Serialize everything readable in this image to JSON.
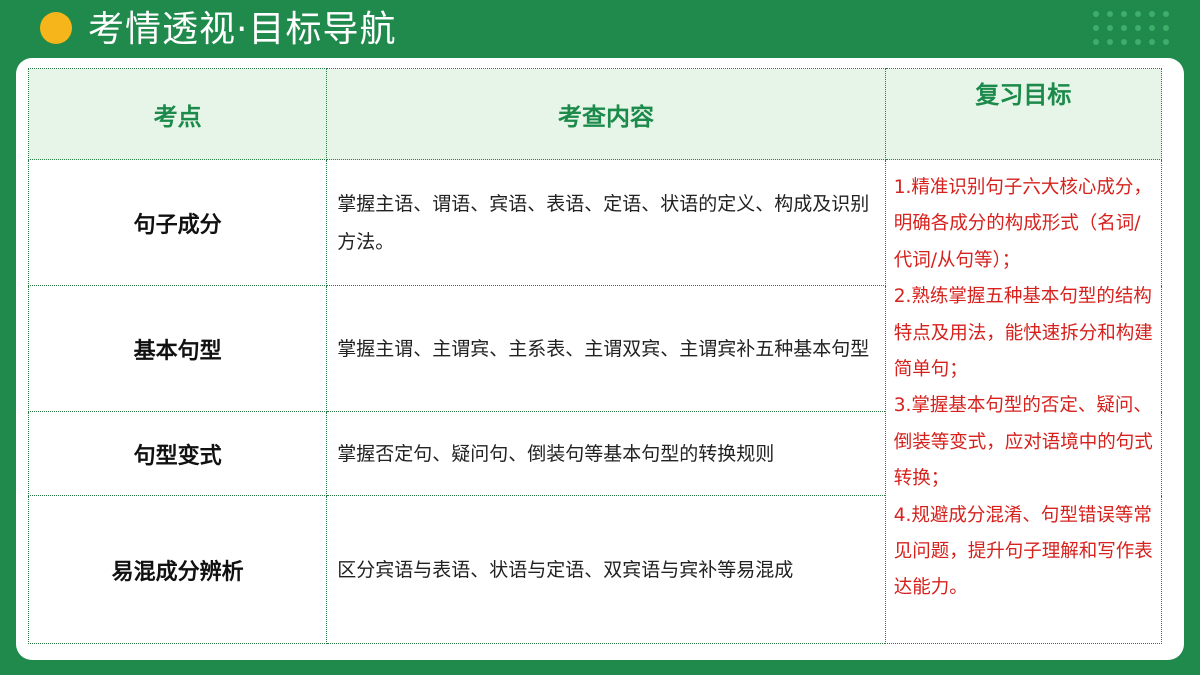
{
  "header": {
    "title": "考情透视·目标导航"
  },
  "colors": {
    "background": "#1f8a4c",
    "accent_dot": "#f6b51a",
    "header_cell_bg": "#e6f5e7",
    "header_text": "#1c8a4b",
    "goal_text": "#d6211d"
  },
  "table": {
    "headers": {
      "point": "考点",
      "content": "考查内容",
      "goal": "复习目标"
    },
    "rows": [
      {
        "point": "句子成分",
        "content": "掌握主语、谓语、宾语、表语、定语、状语的定义、构成及识别方法。"
      },
      {
        "point": "基本句型",
        "content": "掌握主谓、主谓宾、主系表、主谓双宾、主谓宾补五种基本句型"
      },
      {
        "point": "句型变式",
        "content": "掌握否定句、疑问句、倒装句等基本句型的转换规则"
      },
      {
        "point": "易混成分辨析",
        "content": "区分宾语与表语、状语与定语、双宾语与宾补等易混成"
      }
    ],
    "goals": [
      "1.精准识别句子六大核心成分，明确各成分的构成形式（名词/代词/从句等）；",
      "2.熟练掌握五种基本句型的结构特点及用法，能快速拆分和构建简单句；",
      "3.掌握基本句型的否定、疑问、倒装等变式，应对语境中的句式转换；",
      "4.规避成分混淆、句型错误等常见问题，提升句子理解和写作表达能力。"
    ]
  }
}
